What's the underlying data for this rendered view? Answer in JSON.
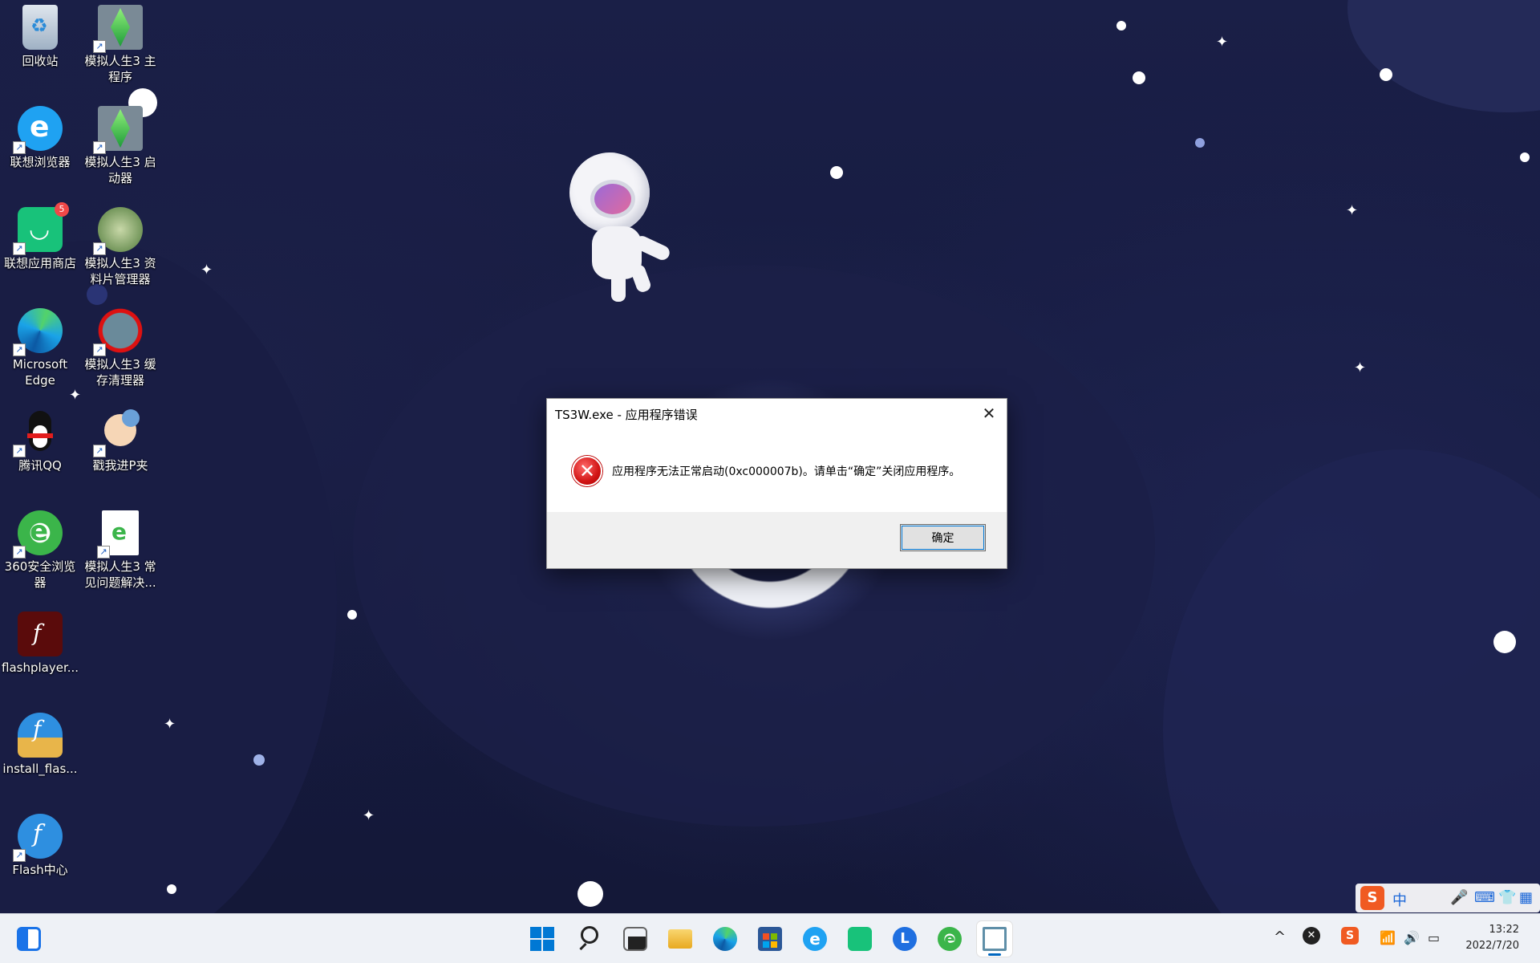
{
  "desktop": {
    "icons": [
      {
        "label": "回收站",
        "icon": "recycle-bin-icon",
        "shortcut": false
      },
      {
        "label": "模拟人生3 主程序",
        "icon": "sims-plumbob-icon",
        "shortcut": true
      },
      {
        "label": "联想浏览器",
        "icon": "lenovo-browser-icon",
        "shortcut": true
      },
      {
        "label": "模拟人生3 启动器",
        "icon": "sims-plumbob-icon",
        "shortcut": true
      },
      {
        "label": "联想应用商店",
        "icon": "lenovo-app-store-icon",
        "shortcut": true,
        "badge": "5"
      },
      {
        "label": "模拟人生3 资料片管理器",
        "icon": "sims-expansion-manager-icon",
        "shortcut": true
      },
      {
        "label": "Microsoft Edge",
        "icon": "edge-icon",
        "shortcut": true
      },
      {
        "label": "模拟人生3 缓存清理器",
        "icon": "sims-cache-cleaner-icon",
        "shortcut": true
      },
      {
        "label": "腾讯QQ",
        "icon": "qq-penguin-icon",
        "shortcut": true
      },
      {
        "label": "戳我进P夹",
        "icon": "cartoon-face-icon",
        "shortcut": true
      },
      {
        "label": "360安全浏览器",
        "icon": "360-browser-icon",
        "shortcut": true
      },
      {
        "label": "模拟人生3 常见问题解决...",
        "icon": "document-ie-icon",
        "shortcut": true
      },
      {
        "label": "flashplayer...",
        "icon": "flash-player-icon",
        "shortcut": false
      },
      {
        "label": "install_flas...",
        "icon": "flash-installer-icon",
        "shortcut": false
      },
      {
        "label": "Flash中心",
        "icon": "flash-center-icon",
        "shortcut": true
      }
    ]
  },
  "dialog": {
    "title": "TS3W.exe - 应用程序错误",
    "close_glyph": "✕",
    "icon": "error-icon",
    "error_glyph": "✕",
    "message": "应用程序无法正常启动(0xc000007b)。请单击“确定”关闭应用程序。",
    "ok_label": "确定"
  },
  "taskbar": {
    "apps": [
      {
        "name": "widgets",
        "icon": "widgets-icon",
        "color": "#1a73e8"
      },
      {
        "name": "start",
        "icon": "windows-start-icon",
        "color": "#0078d4"
      },
      {
        "name": "search",
        "icon": "search-icon",
        "color": "#222222"
      },
      {
        "name": "task-view",
        "icon": "task-view-icon",
        "color": "#222222"
      },
      {
        "name": "file-explorer",
        "icon": "folder-icon",
        "color": "#f5c242"
      },
      {
        "name": "edge",
        "icon": "edge-icon",
        "color": "#1aa3e8"
      },
      {
        "name": "store",
        "icon": "store-icon",
        "color": "#2b7fd9"
      },
      {
        "name": "lenovo-browser",
        "icon": "lenovo-browser-icon",
        "color": "#1fa2f2"
      },
      {
        "name": "lenovo-app-store",
        "icon": "lenovo-app-store-icon",
        "color": "#18c27a"
      },
      {
        "name": "lenovo-vantage",
        "icon": "lenovo-vantage-icon",
        "color": "#1f6fe0"
      },
      {
        "name": "360-browser",
        "icon": "360-browser-icon",
        "color": "#3bb54a"
      },
      {
        "name": "error-window",
        "icon": "app-window-icon",
        "color": "#5f8fa8",
        "active": true
      }
    ],
    "tray": {
      "chevron": "^",
      "ime_label": "中",
      "date": "2022/7/20",
      "time": "13:22"
    }
  },
  "colors": {
    "accent": "#0078d7",
    "error": "#d11414",
    "desktop_bg": "#1a1f47"
  }
}
